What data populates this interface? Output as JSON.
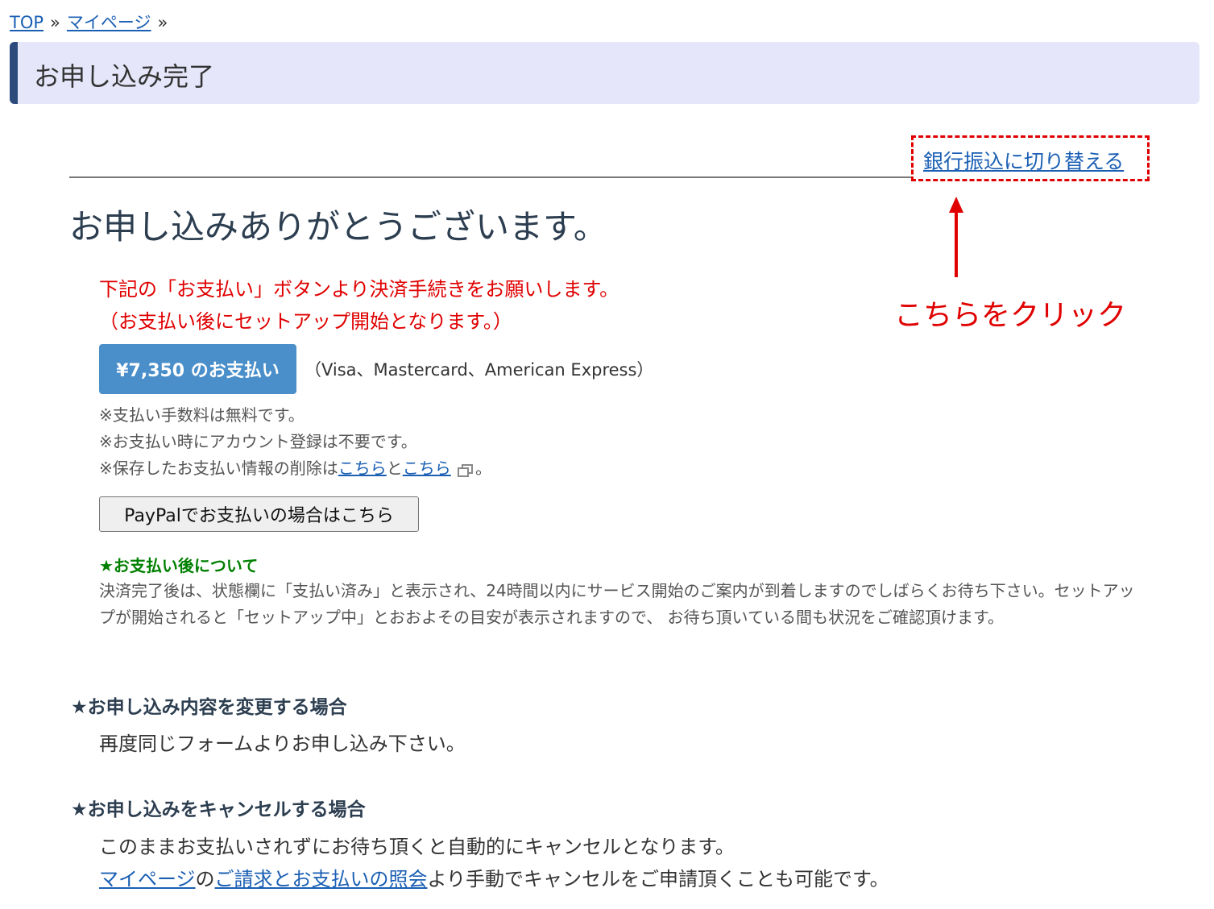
{
  "breadcrumb": {
    "top": "TOP",
    "mypage": "マイページ",
    "sep": "»"
  },
  "header": {
    "title": "お申し込み完了"
  },
  "switch_link": "銀行振込に切り替える",
  "annotation": {
    "click_note": "こちらをクリック",
    "accent_color": "#e00000"
  },
  "thanks": "お申し込みありがとうございます。",
  "red_message": {
    "line1": "下記の「お支払い」ボタンより決済手続きをお願いします。",
    "line2": "（お支払い後にセットアップ開始となります。）"
  },
  "payment": {
    "button_label": "¥7,350 のお支払い",
    "cards": "（Visa、Mastercard、American Express）"
  },
  "notes": {
    "line1": "※支払い手数料は無料です。",
    "line2": "※お支払い時にアカウント登録は不要です。",
    "line3_prefix": "※保存したお支払い情報の削除は",
    "link1": "こちら",
    "and": "と",
    "link2": "こちら",
    "line3_suffix": "。",
    "external_icon": "external-link-icon"
  },
  "paypal_button": "PayPalでお支払いの場合はこちら",
  "after_payment": {
    "title": "★お支払い後について",
    "text": "決済完了後は、状態欄に「支払い済み」と表示され、24時間以内にサービス開始のご案内が到着しますのでしばらくお待ち下さい。セットアップが開始されると「セットアップ中」とおおよその目安が表示されますので、 お待ち頂いている間も状況をご確認頂けます。"
  },
  "change_section": {
    "title": "★お申し込み内容を変更する場合",
    "text": "再度同じフォームよりお申し込み下さい。"
  },
  "cancel_section": {
    "title": "★お申し込みをキャンセルする場合",
    "line1": "このままお支払いされずにお待ち頂くと自動的にキャンセルとなります。",
    "link_mypage": "マイページ",
    "no": "の",
    "link_billing": "ご請求とお支払いの照会",
    "line2_suffix": "より手動でキャンセルをご申請頂くことも可能です。"
  },
  "colors": {
    "link": "#1a5fb4",
    "pay_button": "#4a8fca",
    "header_bg": "#e6e6fa",
    "header_accent": "#2c4a7c",
    "after_title": "#008000"
  }
}
